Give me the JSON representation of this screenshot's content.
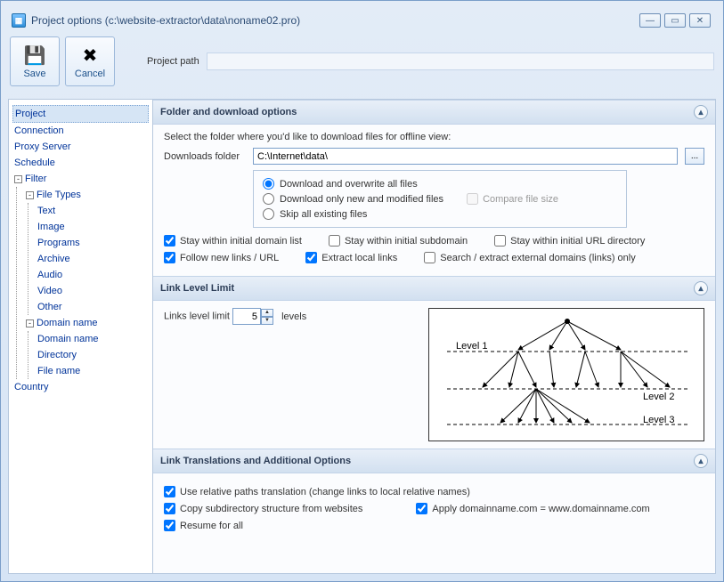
{
  "window": {
    "title": "Project options (c:\\website-extractor\\data\\noname02.pro)"
  },
  "toolbar": {
    "save_label": "Save",
    "cancel_label": "Cancel",
    "path_label": "Project path"
  },
  "tree": {
    "project": "Project",
    "connection": "Connection",
    "proxy": "Proxy Server",
    "schedule": "Schedule",
    "filter": "Filter",
    "filetypes": "File Types",
    "ft": {
      "text": "Text",
      "image": "Image",
      "programs": "Programs",
      "archive": "Archive",
      "audio": "Audio",
      "video": "Video",
      "other": "Other"
    },
    "domainname": "Domain name",
    "dn": {
      "domain": "Domain name",
      "directory": "Directory",
      "filename": "File name"
    },
    "country": "Country"
  },
  "sections": {
    "folder": {
      "header": "Folder and download options",
      "intro": "Select the folder where you'd like to download files for offline view:",
      "folder_label": "Downloads folder",
      "folder_value": "C:\\Internet\\data\\",
      "radio": {
        "overwrite": "Download and overwrite all files",
        "newmod": "Download only new and modified files",
        "skip": "Skip all existing files",
        "compare": "Compare file size"
      },
      "cbx": {
        "stay_domain": "Stay within initial domain list",
        "stay_subdomain": "Stay within initial subdomain",
        "stay_urldir": "Stay within initial URL directory",
        "follow_new": "Follow new links / URL",
        "extract_local": "Extract local links",
        "search_external": "Search / extract external domains (links) only"
      }
    },
    "linklevel": {
      "header": "Link Level Limit",
      "label": "Links level limit",
      "value": "5",
      "suffix": "levels",
      "diagram": {
        "l1": "Level 1",
        "l2": "Level 2",
        "l3": "Level 3"
      }
    },
    "trans": {
      "header": "Link Translations and Additional Options",
      "relative": "Use relative paths translation  (change links to local relative names)",
      "copysub": "Copy subdirectory structure from websites",
      "applydomain": "Apply domainname.com  =  www.domainname.com",
      "resume": "Resume for all"
    }
  }
}
